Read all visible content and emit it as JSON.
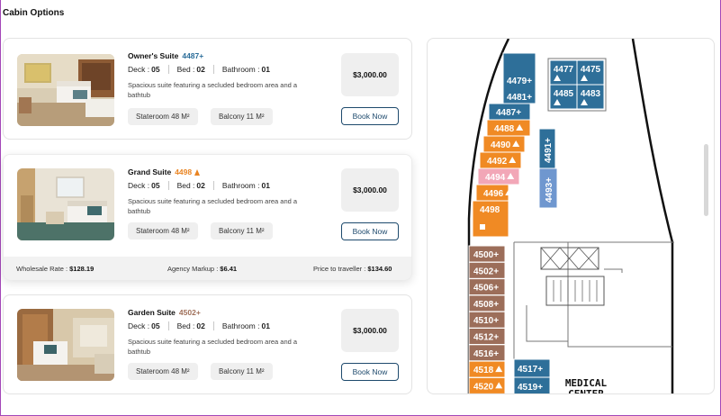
{
  "page": {
    "title": "Cabin Options"
  },
  "labels": {
    "deck": "Deck :",
    "bed": "Bed :",
    "bathroom": "Bathroom :",
    "book": "Book Now"
  },
  "cabins": [
    {
      "name": "Owner's Suite",
      "code": "4487+",
      "code_color": "#2c6e9a",
      "has_triangle": false,
      "deck": "05",
      "bed": "02",
      "bathroom": "01",
      "description": "Spacious suite featuring a secluded bedroom area and a bathtub",
      "stateroom": "Stateroom 48 M²",
      "balcony": "Balcony 11 M²",
      "price": "$3,000.00"
    },
    {
      "name": "Grand Suite",
      "code": "4498",
      "code_color": "#e98422",
      "has_triangle": true,
      "deck": "05",
      "bed": "02",
      "bathroom": "01",
      "description": "Spacious suite featuring a secluded bedroom area and a bathtub",
      "stateroom": "Stateroom 48 M²",
      "balcony": "Balcony 11 M²",
      "price": "$3,000.00",
      "rates": {
        "wholesale_label": "Wholesale Rate :",
        "wholesale": "$128.19",
        "markup_label": "Agency Markup :",
        "markup": "$6.41",
        "traveller_label": "Price to traveller :",
        "traveller": "$134.60"
      }
    },
    {
      "name": "Garden Suite",
      "code": "4502+",
      "code_color": "#a0705a",
      "has_triangle": false,
      "deck": "05",
      "bed": "02",
      "bathroom": "01",
      "description": "Spacious suite featuring a secluded bedroom area and a bathtub",
      "stateroom": "Stateroom 48 M²",
      "balcony": "Balcony 11 M²",
      "price": "$3,000.00"
    }
  ],
  "deck_map": {
    "colors": {
      "blue": "#2e6f99",
      "orange": "#f08a24",
      "pink": "#f2a7b7",
      "brown": "#9c6e5a",
      "lightblue": "#6f97cf"
    },
    "blue_top_cabins": [
      "4479+",
      "4481+"
    ],
    "blue_grid_cabins": [
      "4477",
      "4475",
      "4485",
      "4483"
    ],
    "suite_cabins": [
      {
        "label": "4487+",
        "color": "blue"
      },
      {
        "label": "4488",
        "color": "orange",
        "triangle": true
      },
      {
        "label": "4490",
        "color": "orange",
        "triangle": true
      },
      {
        "label": "4492",
        "color": "orange",
        "triangle": true
      },
      {
        "label": "4494",
        "color": "pink",
        "triangle": true
      },
      {
        "label": "4496",
        "color": "orange",
        "triangle": true
      },
      {
        "label": "4498",
        "color": "orange",
        "square": true
      }
    ],
    "vertical_cabins": [
      "4491+",
      "4493+"
    ],
    "garden_cabins": [
      {
        "label": "4500+",
        "color": "brown"
      },
      {
        "label": "4502+",
        "color": "brown"
      },
      {
        "label": "4506+",
        "color": "brown"
      },
      {
        "label": "4508+",
        "color": "brown"
      },
      {
        "label": "4510+",
        "color": "brown"
      },
      {
        "label": "4512+",
        "color": "brown"
      },
      {
        "label": "4516+",
        "color": "brown"
      },
      {
        "label": "4518",
        "color": "orange",
        "triangle": true
      },
      {
        "label": "4520",
        "color": "orange",
        "triangle": true
      }
    ],
    "right_cabins": [
      "4517+",
      "4519+"
    ],
    "medical_label_1": "MEDICAL",
    "medical_label_2": "CENTER"
  }
}
